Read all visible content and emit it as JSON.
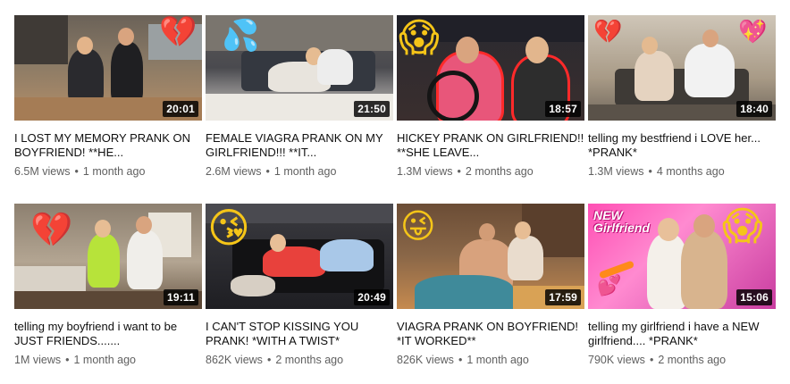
{
  "videos": [
    {
      "title": "I LOST MY MEMORY PRANK ON BOYFRIEND! **HE...",
      "duration": "20:01",
      "views": "6.5M views",
      "age": "1 month ago"
    },
    {
      "title": "FEMALE VIAGRA PRANK ON MY GIRLFRIEND!!! **IT...",
      "duration": "21:50",
      "views": "2.6M views",
      "age": "1 month ago"
    },
    {
      "title": "HICKEY PRANK ON GIRLFRIEND!! **SHE LEAVE...",
      "duration": "18:57",
      "views": "1.3M views",
      "age": "2 months ago"
    },
    {
      "title": "telling my bestfriend i LOVE her... *PRANK*",
      "duration": "18:40",
      "views": "1.3M views",
      "age": "4 months ago"
    },
    {
      "title": "telling my boyfriend i want to be JUST FRIENDS.......",
      "duration": "19:11",
      "views": "1M views",
      "age": "1 month ago"
    },
    {
      "title": "I CAN'T STOP KISSING YOU PRANK! *WITH A TWIST*",
      "duration": "20:49",
      "views": "862K views",
      "age": "2 months ago"
    },
    {
      "title": "VIAGRA PRANK ON BOYFRIEND! *IT WORKED**",
      "duration": "17:59",
      "views": "826K views",
      "age": "1 month ago"
    },
    {
      "title": "telling my girlfriend i have a NEW girlfriend.... *PRANK*",
      "duration": "15:06",
      "views": "790K views",
      "age": "2 months ago"
    }
  ],
  "thumb_overlays": {
    "v8_sticker_text": "NEW\nGirlfriend"
  },
  "separator": "•",
  "colors": {
    "title_text": "#0f0f0f",
    "meta_text": "#606060",
    "duration_bg": "#000000"
  }
}
